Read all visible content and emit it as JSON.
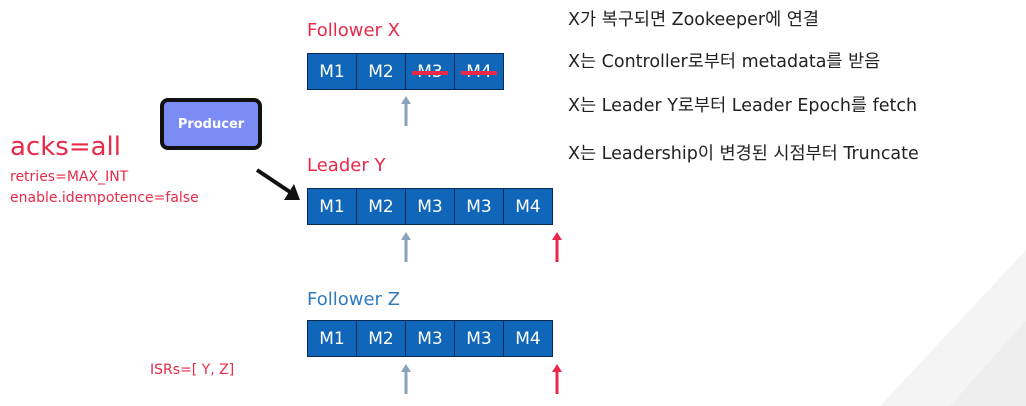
{
  "producer": {
    "label": "Producer"
  },
  "config": {
    "acks": "acks=all",
    "retries": "retries=MAX_INT",
    "idempotence": "enable.idempotence=false",
    "isrs": "ISRs=[ Y, Z]"
  },
  "follower_x": {
    "title": "Follower X",
    "cells": [
      "M1",
      "M2",
      "M3",
      "M4"
    ],
    "struck_cells": [
      "M3",
      "M4"
    ]
  },
  "leader_y": {
    "title": "Leader Y",
    "cells": [
      "M1",
      "M2",
      "M3",
      "M3",
      "M4"
    ]
  },
  "follower_z": {
    "title": "Follower Z",
    "cells": [
      "M1",
      "M2",
      "M3",
      "M3",
      "M4"
    ]
  },
  "notes": [
    "X가 복구되면 Zookeeper에 연결",
    "X는 Controller로부터 metadata를 받음",
    "X는 Leader Y로부터 Leader Epoch를 fetch",
    "X는 Leadership이 변경된 시점부터 Truncate"
  ],
  "colors": {
    "cell_fill": "#1066b8",
    "accent_red": "#e8294a",
    "title_blue": "#2e7bbd",
    "marker_gray": "#8aa3b8",
    "producer_fill": "#7b8cf5"
  }
}
